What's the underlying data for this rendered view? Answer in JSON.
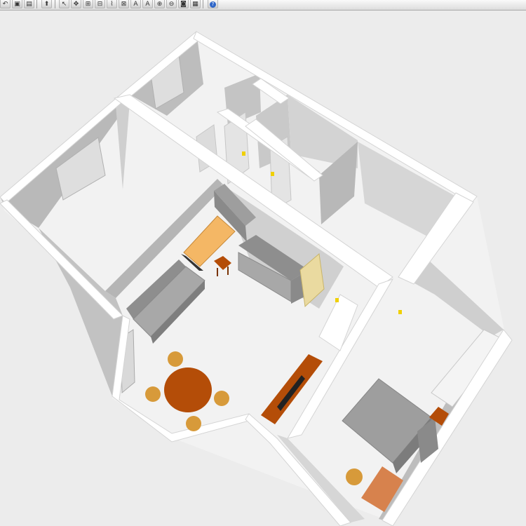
{
  "toolbar": {
    "buttons": [
      {
        "name": "undo-button",
        "icon": "undo-icon",
        "glyph": "↶"
      },
      {
        "name": "delete-button",
        "icon": "delete-icon",
        "glyph": "▣"
      },
      {
        "name": "paste-button",
        "icon": "paste-icon",
        "glyph": "▤"
      },
      {
        "name": "add-furniture-button",
        "icon": "add-furniture-icon",
        "glyph": "⬆"
      },
      {
        "name": "select-mode-button",
        "icon": "arrow-pointer-icon",
        "glyph": "↖"
      },
      {
        "name": "pan-mode-button",
        "icon": "pan-icon",
        "glyph": "✥"
      },
      {
        "name": "create-walls-button",
        "icon": "create-walls-icon",
        "glyph": "⊞"
      },
      {
        "name": "create-rooms-button",
        "icon": "create-rooms-icon",
        "glyph": "⊟"
      },
      {
        "name": "create-polylines-button",
        "icon": "polyline-icon",
        "glyph": "⌇"
      },
      {
        "name": "create-dimensions-button",
        "icon": "dimension-icon",
        "glyph": "⊠"
      },
      {
        "name": "add-text-button",
        "icon": "add-text-icon",
        "glyph": "A"
      },
      {
        "name": "text-style-button",
        "icon": "text-style-icon",
        "glyph": "A"
      },
      {
        "name": "zoom-in-button",
        "icon": "zoom-in-icon",
        "glyph": "⊕"
      },
      {
        "name": "zoom-out-button",
        "icon": "zoom-out-icon",
        "glyph": "⊖"
      },
      {
        "name": "create-photo-button",
        "icon": "camera-icon",
        "glyph": "◙"
      },
      {
        "name": "create-video-button",
        "icon": "video-icon",
        "glyph": "▦"
      },
      {
        "name": "help-button",
        "icon": "help-icon",
        "glyph": "?"
      }
    ]
  },
  "scene": {
    "floor_color": "#ffffff",
    "background_color": "#ececec",
    "wall_top_color": "#ffffff",
    "wall_shadow_color": "#c8c8c8",
    "sofa_color": "#a8a8a8",
    "table_wood_color": "#b44d08",
    "chair_color": "#d79a3a",
    "desk_color": "#f4b765",
    "cabinet_color": "#d7824d",
    "bed_color": "#9e9e9e",
    "screen_color": "#eadaa0"
  }
}
